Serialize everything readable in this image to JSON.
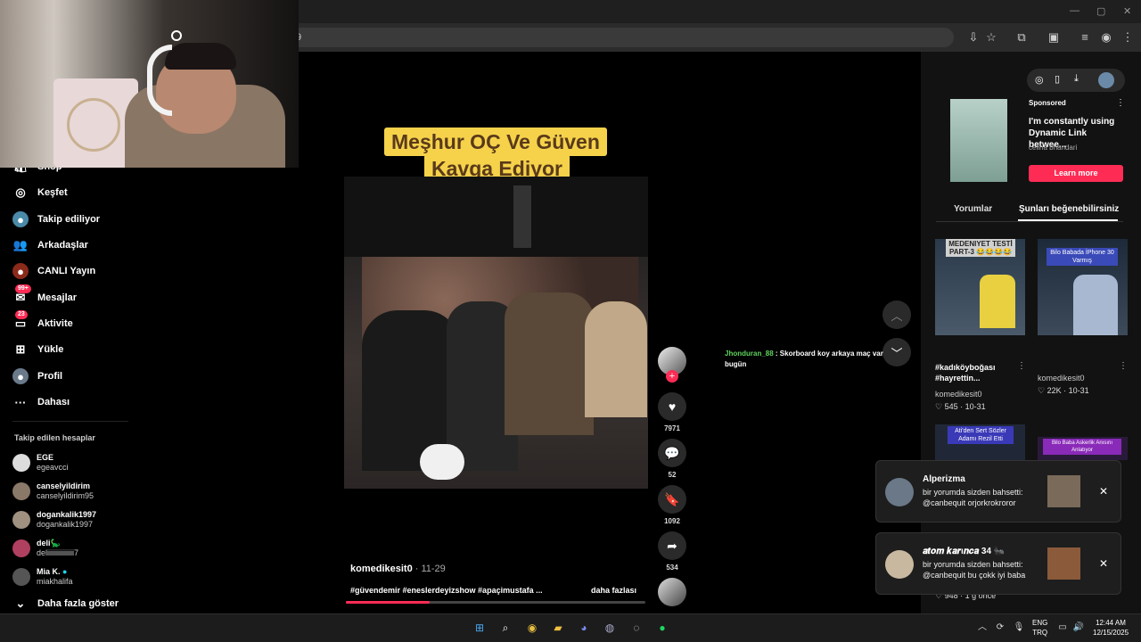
{
  "browser": {
    "url_fragment": "9",
    "window_controls": [
      "—",
      "▢",
      "✕"
    ]
  },
  "sidebar": {
    "items": [
      {
        "label": "Shop",
        "icon": "shop-icon"
      },
      {
        "label": "Keşfet",
        "icon": "compass-icon"
      },
      {
        "label": "Takip ediliyor",
        "icon": "following-icon"
      },
      {
        "label": "Arkadaşlar",
        "icon": "friends-icon"
      },
      {
        "label": "CANLI Yayın",
        "icon": "live-icon"
      },
      {
        "label": "Mesajlar",
        "icon": "messages-icon",
        "badge": "99+"
      },
      {
        "label": "Aktivite",
        "icon": "activity-icon",
        "badge": "23"
      },
      {
        "label": "Yükle",
        "icon": "upload-icon"
      },
      {
        "label": "Profil",
        "icon": "profile-icon"
      },
      {
        "label": "Dahası",
        "icon": "more-icon"
      }
    ],
    "following_title": "Takip edilen hesaplar",
    "accounts": [
      {
        "name": "EGE",
        "handle": "egeavcci"
      },
      {
        "name": "canselyildirim",
        "handle": "canselyildirim95"
      },
      {
        "name": "dogankalik1997",
        "handle": "dogankalik1997"
      },
      {
        "name": "deli🦕",
        "handle": "deliiiiiiiiiiiiiii7"
      },
      {
        "name": "Mia K.",
        "handle": "miakhalifa"
      }
    ],
    "show_more": "Daha fazla göster"
  },
  "video": {
    "caption_line1": "Meşhur OÇ Ve Güven",
    "caption_line2": "Kavga Ediyor",
    "author": "komedikesit0",
    "date": " · 11-29",
    "tags": "#güvendemir #eneslerdeyizshow #apaçimustafa ...",
    "more": "daha fazlası",
    "progress": 0.28
  },
  "actions": {
    "likes": "7971",
    "comments": "52",
    "saves": "1092",
    "shares": "534"
  },
  "chat": {
    "user": "Jhonduran_88",
    "text": " : Skorboard koy arkaya maç var bugün"
  },
  "right_panel": {
    "ad": {
      "sponsored": "Sponsored",
      "text": "I'm constantly using Dynamic Link betwee...",
      "user": "celina bhandari",
      "cta": "Learn more"
    },
    "tabs": [
      "Yorumlar",
      "Şunları beğenebilirsiniz"
    ],
    "videos": [
      {
        "overlay": "MEDENIYET TESTİ PART-3 😂😂😂😂",
        "title": "#kadıköyboğası #hayrettin...",
        "author": "komedikesit0",
        "stats": "♡ 545 · 10-31"
      },
      {
        "overlay": "Bilo Babada İPhone 30 Varmış",
        "title": "",
        "author": "komedikesit0",
        "stats": "♡ 22K · 10-31"
      },
      {
        "overlay": "Ati'den Sert Sözler Adamı Rezil Etti",
        "title": "",
        "author": "",
        "stats": "♡ 948 · 1 g önce"
      },
      {
        "overlay": "Bilo Baba Askerlik Anısını Anlatıyor",
        "title": "",
        "author": "",
        "stats": ""
      }
    ]
  },
  "notifications": [
    {
      "name": "Alperizma",
      "line1": "bir yorumda sizden bahsetti:",
      "line2": "@canbequit orjorkrokroror"
    },
    {
      "name": "𝒂𝒕𝒐𝒎 𝒌𝒂𝒓ı𝒏𝒄𝒂 34 🐜",
      "line1": "bir yorumda sizden bahsetti:",
      "line2": "@canbequit bu çokk iyi baba"
    }
  ],
  "taskbar": {
    "lang1": "ENG",
    "lang2": "TRQ",
    "time": "12:44 AM",
    "date": "12/15/2025"
  }
}
